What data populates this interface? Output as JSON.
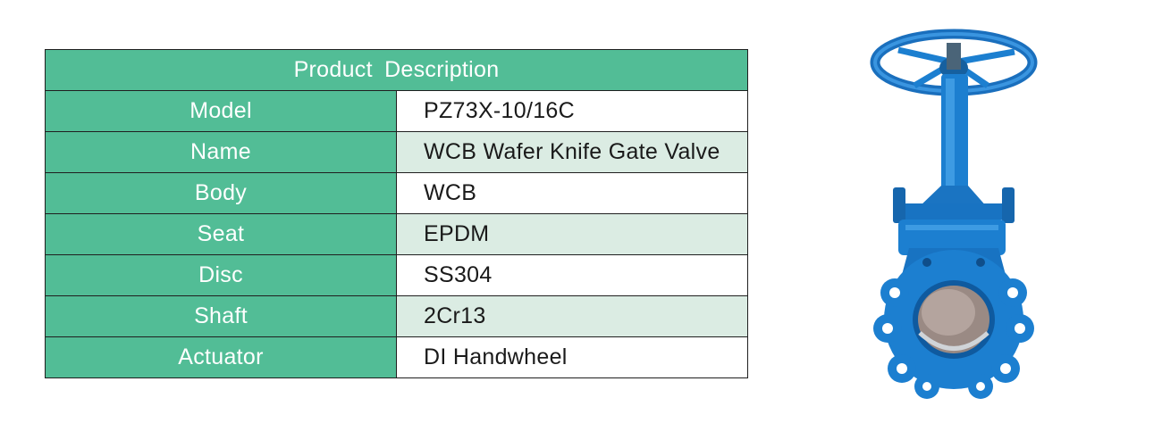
{
  "table": {
    "title": "Product  Description",
    "rows": [
      {
        "label": "Model",
        "value": "PZ73X-10/16C"
      },
      {
        "label": "Name",
        "value": "WCB Wafer Knife Gate Valve"
      },
      {
        "label": "Body",
        "value": "WCB"
      },
      {
        "label": "Seat",
        "value": "EPDM"
      },
      {
        "label": "Disc",
        "value": "SS304"
      },
      {
        "label": "Shaft",
        "value": "2Cr13"
      },
      {
        "label": "Actuator",
        "value": "DI Handwheel"
      }
    ]
  },
  "colors": {
    "header_green": "#52bd96",
    "alt_row": "#dbece3",
    "valve_blue": "#1c7fd0"
  }
}
